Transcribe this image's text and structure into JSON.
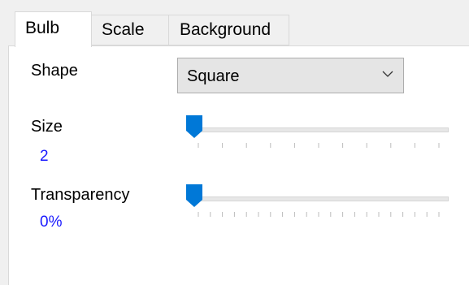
{
  "tabs": {
    "bulb": "Bulb",
    "scale": "Scale",
    "background": "Background"
  },
  "shape": {
    "label": "Shape",
    "selected": "Square"
  },
  "size": {
    "label": "Size",
    "value": "2",
    "level": 0
  },
  "transparency": {
    "label": "Transparency",
    "value": "0%",
    "level": 0
  },
  "colors": {
    "accent": "#0078d7",
    "value_text": "#1a1aff",
    "panel": "#ffffff",
    "window": "#f0f0f0"
  },
  "icons": {
    "dropdown": "chevron-down-icon"
  }
}
